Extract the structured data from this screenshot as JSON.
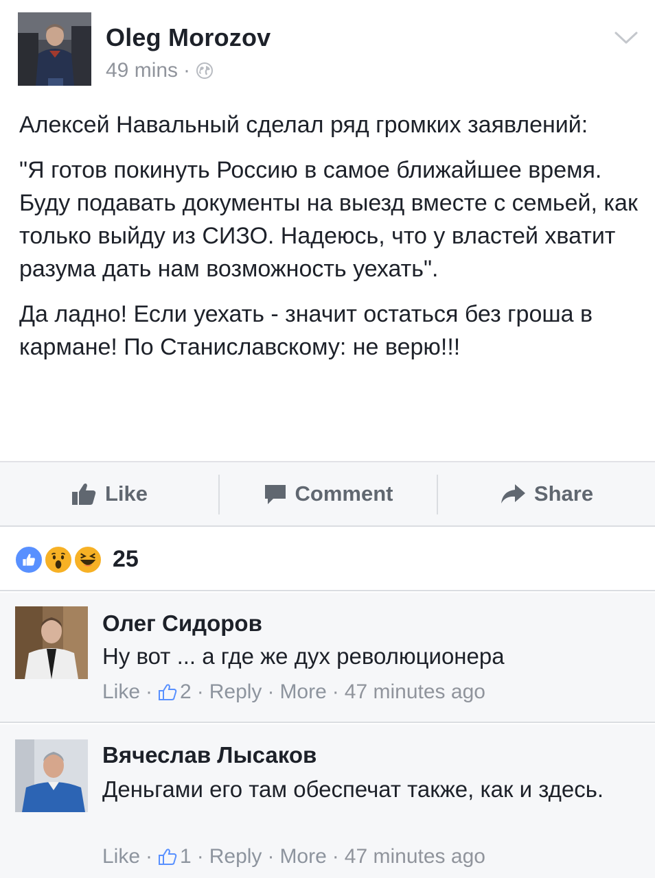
{
  "post": {
    "author": "Oleg Morozov",
    "time": "49 mins",
    "separator": "·",
    "paragraphs": [
      "Алексей Навальный сделал ряд громких заявлений:",
      "\"Я готов покинуть Россию в самое ближайшее время. Буду подавать документы на выезд вместе с семьей, как только выйду из СИЗО. Надеюсь, что у властей хватит разума дать нам возможность уехать\".",
      "Да ладно! Если уехать - значит остаться без гроша в кармане! По Станиславскому: не верю!!!"
    ]
  },
  "actions": {
    "like": "Like",
    "comment": "Comment",
    "share": "Share"
  },
  "reactions": {
    "count": "25",
    "icons": [
      "like-icon",
      "wow-icon",
      "haha-icon"
    ],
    "colors": {
      "like": "#5890ff",
      "wow": "#f7b125",
      "haha": "#f7b125"
    }
  },
  "comments": [
    {
      "name": "Олег Сидоров",
      "text": "Ну вот ... а где же дух революционера",
      "like": "Like",
      "likes": "2",
      "reply": "Reply",
      "more": "More",
      "time": "47 minutes ago"
    },
    {
      "name": "Вячеслав Лысаков",
      "text": "Деньгами его там обеспечат также, как и здесь.",
      "like": "Like",
      "likes": "1",
      "reply": "Reply",
      "more": "More",
      "time": "47 minutes ago"
    }
  ],
  "colors": {
    "text": "#1d2129",
    "meta": "#90949c",
    "action": "#606770",
    "bar_bg": "#f6f7f9",
    "border": "#dadde1"
  }
}
